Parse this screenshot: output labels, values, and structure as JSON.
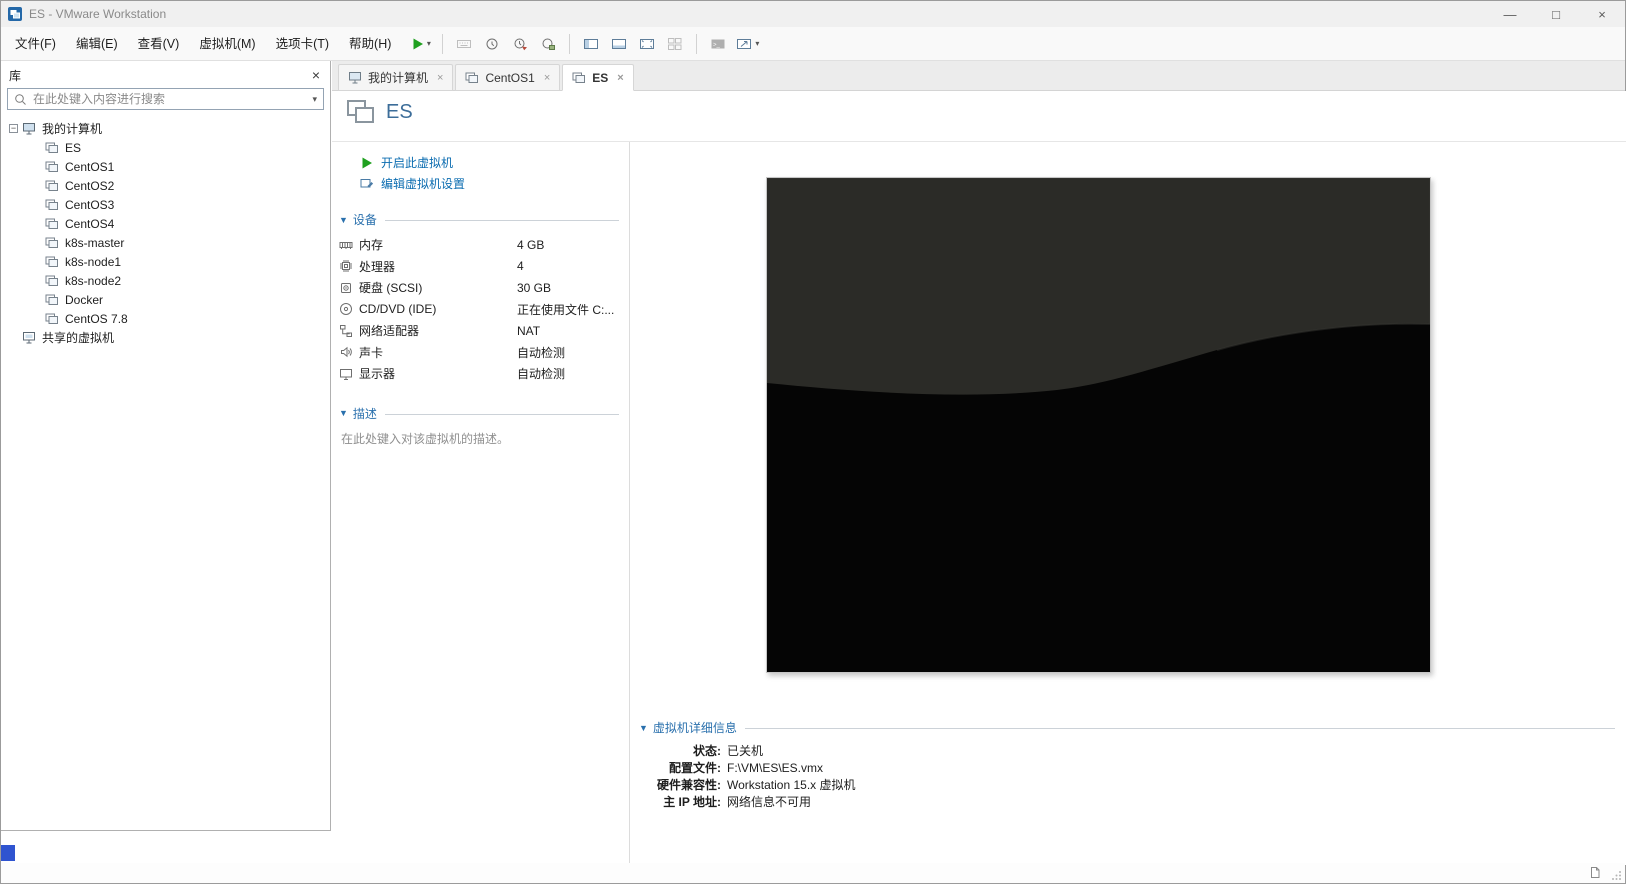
{
  "colors": {
    "accent_blue": "#2f54d0",
    "link_blue": "#0b6cb0",
    "header_blue": "#2a70ad",
    "play_green": "#1fa01f",
    "preview_dark": "#2b2b27"
  },
  "window": {
    "title": "ES - VMware Workstation",
    "minimize_label": "—",
    "maximize_label": "□",
    "close_label": "×"
  },
  "menubar": {
    "items": [
      {
        "id": "file",
        "label": "文件(F)"
      },
      {
        "id": "edit",
        "label": "编辑(E)"
      },
      {
        "id": "view",
        "label": "查看(V)"
      },
      {
        "id": "vm",
        "label": "虚拟机(M)"
      },
      {
        "id": "tabs",
        "label": "选项卡(T)"
      },
      {
        "id": "help",
        "label": "帮助(H)"
      }
    ]
  },
  "toolbar": {
    "buttons": [
      {
        "id": "power-on",
        "icon": "play-icon",
        "enabled": true,
        "dropdown": true
      },
      {
        "id": "sep1",
        "separator": true
      },
      {
        "id": "send-ctrl-alt-del",
        "icon": "keyboard-icon",
        "enabled": false
      },
      {
        "id": "snapshot-take",
        "icon": "snapshot-take-icon",
        "enabled": true
      },
      {
        "id": "snapshot-revert",
        "icon": "snapshot-revert-icon",
        "enabled": true
      },
      {
        "id": "snapshot-manage",
        "icon": "snapshot-manage-icon",
        "enabled": true
      },
      {
        "id": "sep2",
        "separator": true
      },
      {
        "id": "show-library",
        "icon": "library-pane-icon",
        "enabled": true
      },
      {
        "id": "show-thumbnail-bar",
        "icon": "thumbnail-bar-icon",
        "enabled": true
      },
      {
        "id": "fullscreen",
        "icon": "fullscreen-icon",
        "enabled": true
      },
      {
        "id": "unity",
        "icon": "unity-icon",
        "enabled": false
      },
      {
        "id": "sep3",
        "separator": true
      },
      {
        "id": "console",
        "icon": "console-icon",
        "enabled": false
      },
      {
        "id": "display-stretch",
        "icon": "stretch-icon",
        "enabled": true,
        "dropdown": true
      }
    ]
  },
  "sidebar": {
    "title": "库",
    "close_label": "×",
    "search_placeholder": "在此处键入内容进行搜索",
    "tree": {
      "root_label": "我的计算机",
      "vms": [
        "ES",
        "CentOS1",
        "CentOS2",
        "CentOS3",
        "CentOS4",
        "k8s-master",
        "k8s-node1",
        "k8s-node2",
        "Docker",
        "CentOS 7.8"
      ],
      "shared_label": "共享的虚拟机"
    }
  },
  "tabstrip": {
    "tabs": [
      {
        "label": "我的计算机",
        "active": false,
        "icon": "home-tab-icon",
        "close": "×"
      },
      {
        "label": "CentOS1",
        "active": false,
        "icon": "vm-tab-icon",
        "close": "×"
      },
      {
        "label": "ES",
        "active": true,
        "icon": "vm-tab-icon",
        "close": "×"
      }
    ]
  },
  "vm_page": {
    "name": "ES",
    "actions": [
      {
        "id": "power-on-vm",
        "label": "开启此虚拟机",
        "icon": "play-icon"
      },
      {
        "id": "edit-vm-settings",
        "label": "编辑虚拟机设置",
        "icon": "edit-settings-icon"
      }
    ],
    "devices_section": {
      "title": "设备",
      "rows": [
        {
          "name": "内存",
          "value": "4 GB",
          "icon": "memory-icon"
        },
        {
          "name": "处理器",
          "value": "4",
          "icon": "processor-icon"
        },
        {
          "name": "硬盘 (SCSI)",
          "value": "30 GB",
          "icon": "disk-icon"
        },
        {
          "name": "CD/DVD (IDE)",
          "value": "正在使用文件 C:...",
          "icon": "cd-icon"
        },
        {
          "name": "网络适配器",
          "value": "NAT",
          "icon": "network-icon"
        },
        {
          "name": "声卡",
          "value": "自动检测",
          "icon": "sound-icon"
        },
        {
          "name": "显示器",
          "value": "自动检测",
          "icon": "display-icon"
        }
      ]
    },
    "description_section": {
      "title": "描述",
      "placeholder": "在此处键入对该虚拟机的描述。"
    },
    "details_section": {
      "title": "虚拟机详细信息",
      "rows": [
        {
          "label": "状态:",
          "value": "已关机"
        },
        {
          "label": "配置文件:",
          "value": "F:\\VM\\ES\\ES.vmx"
        },
        {
          "label": "硬件兼容性:",
          "value": "Workstation 15.x 虚拟机"
        },
        {
          "label": "主 IP 地址:",
          "value": "网络信息不可用"
        }
      ]
    }
  }
}
